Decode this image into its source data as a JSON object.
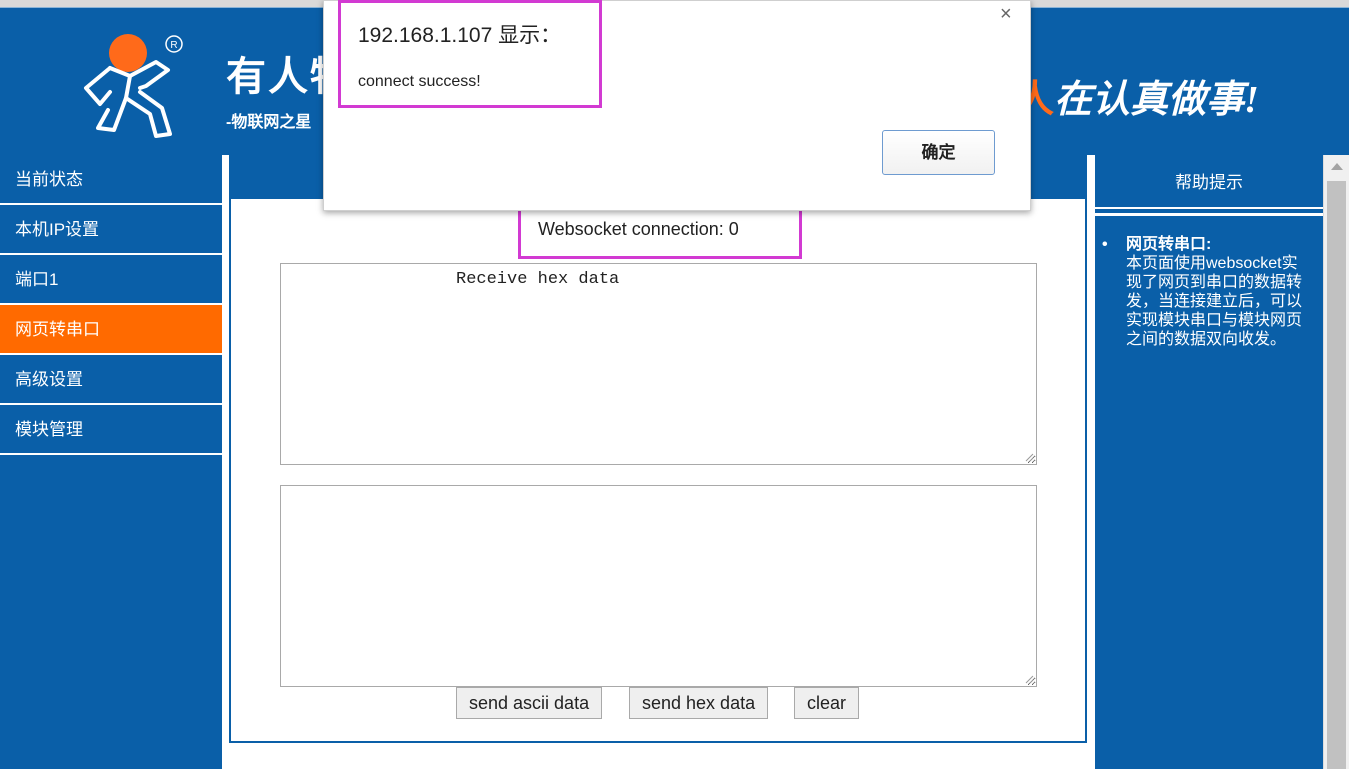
{
  "header": {
    "brand_title": "有人物联网",
    "brand_subtitle": "-物联网之星",
    "slogan_accent": "人",
    "slogan_rest": "在认真做事!"
  },
  "sidebar": {
    "items": [
      {
        "label": "当前状态",
        "active": false
      },
      {
        "label": "本机IP设置",
        "active": false
      },
      {
        "label": "端口1",
        "active": false
      },
      {
        "label": "网页转串口",
        "active": true
      },
      {
        "label": "高级设置",
        "active": false
      },
      {
        "label": "模块管理",
        "active": false
      }
    ]
  },
  "main": {
    "ws_status": "Websocket connection: 0",
    "receive_text": "Receive hex data",
    "send_text": "",
    "buttons": {
      "send_ascii": "send ascii data",
      "send_hex": "send hex data",
      "clear": "clear"
    }
  },
  "help": {
    "header": "帮助提示",
    "bullet": "•",
    "title": "网页转串口:",
    "text": "本页面使用websocket实现了网页到串口的数据转发，当连接建立后，可以实现模块串口与模块网页之间的数据双向收发。"
  },
  "dialog": {
    "title": "192.168.1.107 显示：",
    "message": "connect success!",
    "ok_label": "确定",
    "close_glyph": "×"
  },
  "colors": {
    "primary_blue": "#0a5fa8",
    "active_orange": "#ff6a00",
    "highlight_magenta": "#d23ad2"
  }
}
